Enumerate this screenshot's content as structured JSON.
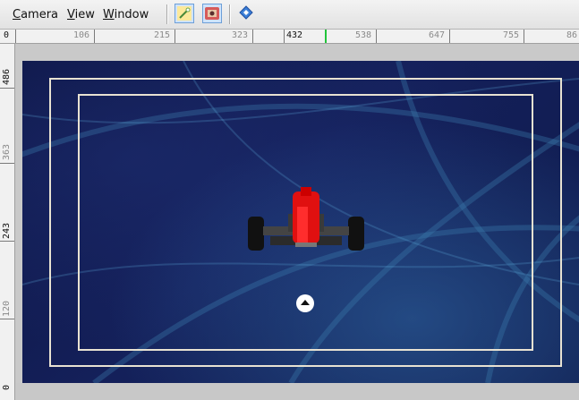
{
  "menu": {
    "camera": "Camera",
    "view": "View",
    "window": "Window"
  },
  "toolbar": {
    "tools": [
      {
        "icon": "magic-wand-icon",
        "active": true
      },
      {
        "icon": "render-view-icon",
        "active": true
      },
      {
        "icon": "navigation-diamond-icon",
        "active": false
      }
    ]
  },
  "ruler": {
    "horizontal_labels": [
      "0",
      "106",
      "215",
      "323",
      "432",
      "538",
      "647",
      "755",
      "86"
    ],
    "horizontal_active": "432",
    "vertical_labels": [
      "486",
      "363",
      "243",
      "120",
      "0"
    ],
    "vertical_active": [
      "486",
      "243",
      "0"
    ]
  },
  "colors": {
    "viewport_bg": "#121c52",
    "safe_frame": "#e8e2d2",
    "car_body": "#e01010",
    "ruler_marker": "#21c43a"
  }
}
